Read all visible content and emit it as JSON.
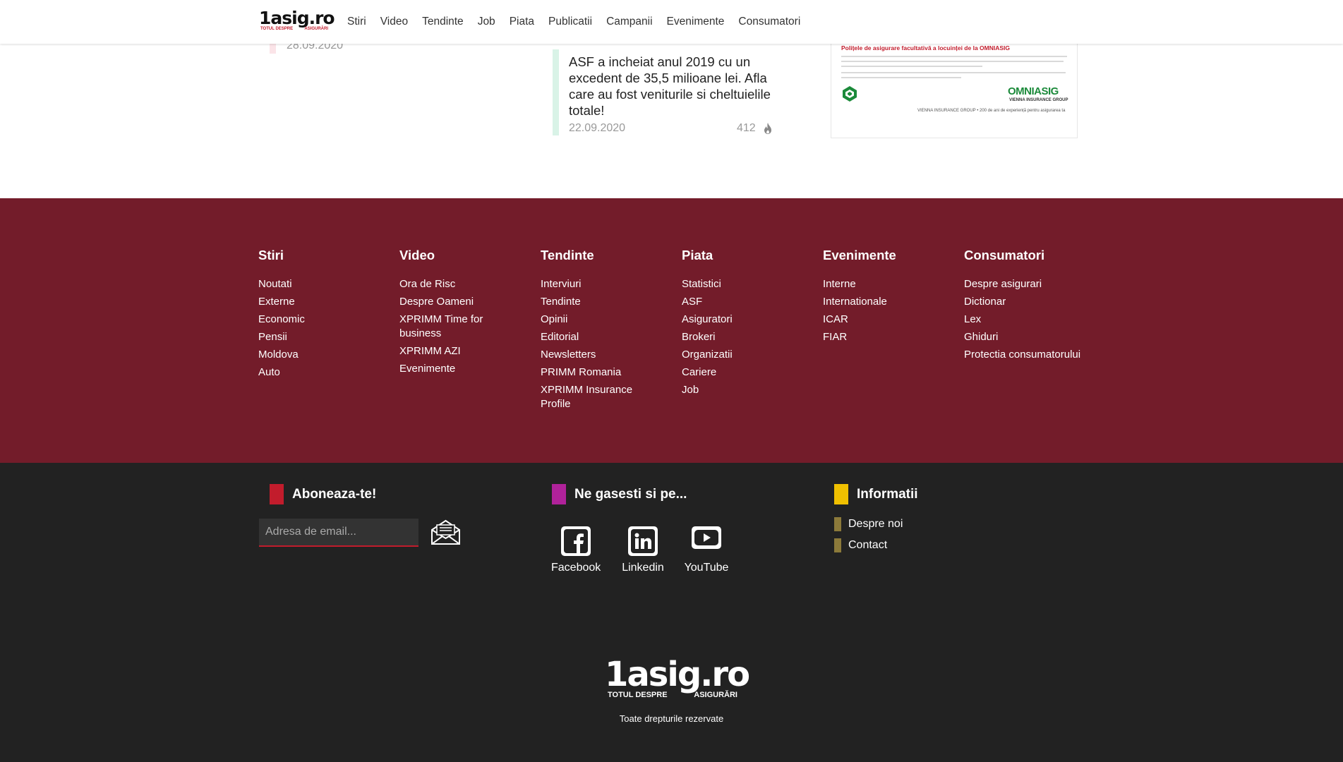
{
  "header": {
    "logo_main": "1asig.ro",
    "logo_sub_left": "TOTUL DESPRE",
    "logo_sub_right": "ASIGURĂRI",
    "nav": [
      "Stiri",
      "Video",
      "Tendinte",
      "Job",
      "Piata",
      "Publicatii",
      "Campanii",
      "Evenimente",
      "Consumatori"
    ]
  },
  "content": {
    "left_date": "28.09.2020",
    "article": {
      "title": "ASF a incheiat anul 2019 cu un excedent de 35,5 milioane lei. Afla care au fost veniturile si cheltuielile totale!",
      "date": "22.09.2020",
      "views": "412",
      "views_icon": "fire-icon"
    },
    "ad": {
      "title": "Polițele de asigurare facultativă a locuinței de la OMNIASIG",
      "brand": "OMNIASIG",
      "brand_sub": "VIENNA INSURANCE GROUP",
      "footer": "VIENNA INSURANCE GROUP • 200 de ani de experiență pentru asigurarea ta"
    }
  },
  "footer_columns": [
    {
      "title": "Stiri",
      "links": [
        "Noutati",
        "Externe",
        "Economic",
        "Pensii",
        "Moldova",
        "Auto"
      ]
    },
    {
      "title": "Video",
      "links": [
        "Ora de Risc",
        "Despre Oameni",
        "XPRIMM Time for business",
        "XPRIMM AZI",
        "Evenimente"
      ]
    },
    {
      "title": "Tendinte",
      "links": [
        "Interviuri",
        "Tendinte",
        "Opinii",
        "Editorial",
        "Newsletters",
        "PRIMM Romania",
        "XPRIMM Insurance Profile"
      ]
    },
    {
      "title": "Piata",
      "links": [
        "Statistici",
        "ASF",
        "Asiguratori",
        "Brokeri",
        "Organizatii",
        "Cariere",
        "Job"
      ]
    },
    {
      "title": "Evenimente",
      "links": [
        "Interne",
        "Internationale",
        "ICAR",
        "FIAR"
      ]
    },
    {
      "title": "Consumatori",
      "links": [
        "Despre asigurari",
        "Dictionar",
        "Lex",
        "Ghiduri",
        "Protectia consumatorului"
      ]
    }
  ],
  "subscribe": {
    "title": "Aboneaza-te!",
    "email_placeholder": "Adresa de email...",
    "accent": "#c21c2c"
  },
  "social": {
    "title": "Ne gasesti si pe...",
    "accent": "#b0229a",
    "items": [
      {
        "label": "Facebook",
        "icon": "facebook-icon"
      },
      {
        "label": "Linkedin",
        "icon": "linkedin-icon"
      },
      {
        "label": "YouTube",
        "icon": "youtube-icon"
      }
    ]
  },
  "info": {
    "title": "Informatii",
    "accent": "#f0c000",
    "links": [
      "Despre noi",
      "Contact"
    ]
  },
  "bottom": {
    "logo_main": "1asig.ro",
    "logo_sub_left": "TOTUL DESPRE",
    "logo_sub_right": "ASIGURĂRI",
    "rights": "Toate drepturile rezervate"
  },
  "colors": {
    "footer_red": "#731c2a",
    "footer_dark": "#222222"
  }
}
